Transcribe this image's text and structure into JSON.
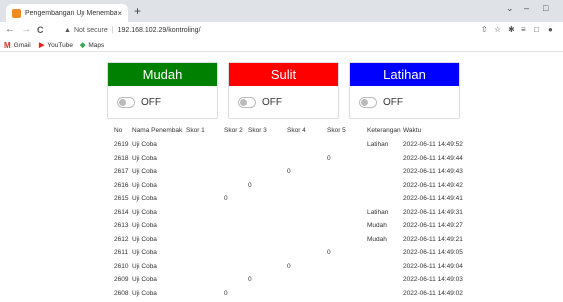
{
  "browser": {
    "tab_title": "Pengembangan Uji Menembak I",
    "tab_close": "×",
    "new_tab": "+",
    "window_controls": [
      "⌄",
      "–",
      "□"
    ],
    "nav": {
      "back": "←",
      "forward": "→",
      "reload": "C"
    },
    "omnibox": {
      "security_icon": "warning-icon",
      "security_text": "Not secure",
      "separator": "|",
      "url": "192.168.102.29/kontroling/"
    },
    "bookmarks": [
      {
        "icon": "M",
        "label": "Gmail",
        "color": "#d93025"
      },
      {
        "icon": "▶",
        "label": "YouTube",
        "color": "#e62117"
      },
      {
        "icon": "◆",
        "label": "Maps",
        "color": "#34a853"
      }
    ]
  },
  "modes": [
    {
      "label": "Mudah",
      "color": "#008000",
      "state": "OFF"
    },
    {
      "label": "Sulit",
      "color": "#ff0000",
      "state": "OFF"
    },
    {
      "label": "Latihan",
      "color": "#0000ff",
      "state": "OFF"
    }
  ],
  "table": {
    "headers": [
      "No",
      "Nama Penembak",
      "Skor 1",
      "Skor 2",
      "Skor 3",
      "Skor 4",
      "Skor 5",
      "Keterangan",
      "Waktu"
    ],
    "rows": [
      {
        "no": "2619",
        "nama": "Uji Coba",
        "s1": "",
        "s2": "",
        "s3": "",
        "s4": "",
        "s5": "",
        "ket": "Latihan",
        "waktu": "2022-06-11 14:49:52"
      },
      {
        "no": "2618",
        "nama": "Uji Coba",
        "s1": "",
        "s2": "",
        "s3": "",
        "s4": "",
        "s5": "0",
        "ket": "",
        "waktu": "2022-06-11 14:49:44"
      },
      {
        "no": "2617",
        "nama": "Uji Coba",
        "s1": "",
        "s2": "",
        "s3": "",
        "s4": "0",
        "s5": "",
        "ket": "",
        "waktu": "2022-06-11 14:49:43"
      },
      {
        "no": "2616",
        "nama": "Uji Coba",
        "s1": "",
        "s2": "",
        "s3": "0",
        "s4": "",
        "s5": "",
        "ket": "",
        "waktu": "2022-06-11 14:49:42"
      },
      {
        "no": "2615",
        "nama": "Uji Coba",
        "s1": "",
        "s2": "0",
        "s3": "",
        "s4": "",
        "s5": "",
        "ket": "",
        "waktu": "2022-06-11 14:49:41"
      },
      {
        "no": "2614",
        "nama": "Uji Coba",
        "s1": "",
        "s2": "",
        "s3": "",
        "s4": "",
        "s5": "",
        "ket": "Latihan",
        "waktu": "2022-06-11 14:49:31"
      },
      {
        "no": "2613",
        "nama": "Uji Coba",
        "s1": "",
        "s2": "",
        "s3": "",
        "s4": "",
        "s5": "",
        "ket": "Mudah",
        "waktu": "2022-06-11 14:49:27"
      },
      {
        "no": "2612",
        "nama": "Uji Coba",
        "s1": "",
        "s2": "",
        "s3": "",
        "s4": "",
        "s5": "",
        "ket": "Mudah",
        "waktu": "2022-06-11 14:49:21"
      },
      {
        "no": "2611",
        "nama": "Uji Coba",
        "s1": "",
        "s2": "",
        "s3": "",
        "s4": "",
        "s5": "0",
        "ket": "",
        "waktu": "2022-06-11 14:49:05"
      },
      {
        "no": "2610",
        "nama": "Uji Coba",
        "s1": "",
        "s2": "",
        "s3": "",
        "s4": "0",
        "s5": "",
        "ket": "",
        "waktu": "2022-06-11 14:49:04"
      },
      {
        "no": "2609",
        "nama": "Uji Coba",
        "s1": "",
        "s2": "",
        "s3": "0",
        "s4": "",
        "s5": "",
        "ket": "",
        "waktu": "2022-06-11 14:49:03"
      },
      {
        "no": "2608",
        "nama": "Uji Coba",
        "s1": "",
        "s2": "0",
        "s3": "",
        "s4": "",
        "s5": "",
        "ket": "",
        "waktu": "2022-06-11 14:49:02"
      }
    ]
  }
}
